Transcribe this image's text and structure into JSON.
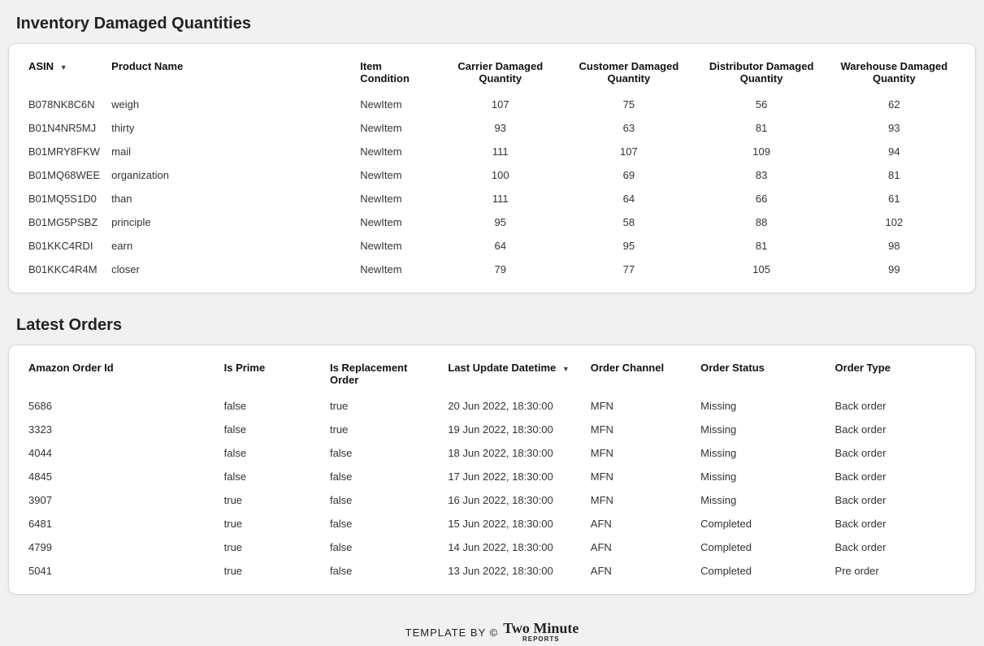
{
  "inventory": {
    "title": "Inventory Damaged Quantities",
    "headers": {
      "asin": "ASIN",
      "product_name": "Product Name",
      "item_condition": "Item Condition",
      "carrier": "Carrier Damaged Quantity",
      "customer": "Customer Damaged Quantity",
      "distributor": "Distributor Damaged Quantity",
      "warehouse": "Warehouse Damaged Quantity"
    },
    "rows": [
      {
        "asin": "B078NK8C6N",
        "product_name": "weigh",
        "item_condition": "NewItem",
        "carrier": "107",
        "customer": "75",
        "distributor": "56",
        "warehouse": "62"
      },
      {
        "asin": "B01N4NR5MJ",
        "product_name": "thirty",
        "item_condition": "NewItem",
        "carrier": "93",
        "customer": "63",
        "distributor": "81",
        "warehouse": "93"
      },
      {
        "asin": "B01MRY8FKW",
        "product_name": "mail",
        "item_condition": "NewItem",
        "carrier": "111",
        "customer": "107",
        "distributor": "109",
        "warehouse": "94"
      },
      {
        "asin": "B01MQ68WEE",
        "product_name": "organization",
        "item_condition": "NewItem",
        "carrier": "100",
        "customer": "69",
        "distributor": "83",
        "warehouse": "81"
      },
      {
        "asin": "B01MQ5S1D0",
        "product_name": "than",
        "item_condition": "NewItem",
        "carrier": "111",
        "customer": "64",
        "distributor": "66",
        "warehouse": "61"
      },
      {
        "asin": "B01MG5PSBZ",
        "product_name": "principle",
        "item_condition": "NewItem",
        "carrier": "95",
        "customer": "58",
        "distributor": "88",
        "warehouse": "102"
      },
      {
        "asin": "B01KKC4RDI",
        "product_name": "earn",
        "item_condition": "NewItem",
        "carrier": "64",
        "customer": "95",
        "distributor": "81",
        "warehouse": "98"
      },
      {
        "asin": "B01KKC4R4M",
        "product_name": "closer",
        "item_condition": "NewItem",
        "carrier": "79",
        "customer": "77",
        "distributor": "105",
        "warehouse": "99"
      }
    ]
  },
  "orders": {
    "title": "Latest Orders",
    "headers": {
      "order_id": "Amazon Order Id",
      "is_prime": "Is Prime",
      "is_replacement": "Is Replacement Order",
      "last_update": "Last Update Datetime",
      "order_channel": "Order Channel",
      "order_status": "Order Status",
      "order_type": "Order Type"
    },
    "rows": [
      {
        "order_id": "5686",
        "is_prime": "false",
        "is_replacement": "true",
        "last_update": "20 Jun 2022, 18:30:00",
        "order_channel": "MFN",
        "order_status": "Missing",
        "order_type": "Back order"
      },
      {
        "order_id": "3323",
        "is_prime": "false",
        "is_replacement": "true",
        "last_update": "19 Jun 2022, 18:30:00",
        "order_channel": "MFN",
        "order_status": "Missing",
        "order_type": "Back order"
      },
      {
        "order_id": "4044",
        "is_prime": "false",
        "is_replacement": "false",
        "last_update": "18 Jun 2022, 18:30:00",
        "order_channel": "MFN",
        "order_status": "Missing",
        "order_type": "Back order"
      },
      {
        "order_id": "4845",
        "is_prime": "false",
        "is_replacement": "false",
        "last_update": "17 Jun 2022, 18:30:00",
        "order_channel": "MFN",
        "order_status": "Missing",
        "order_type": "Back order"
      },
      {
        "order_id": "3907",
        "is_prime": "true",
        "is_replacement": "false",
        "last_update": "16 Jun 2022, 18:30:00",
        "order_channel": "MFN",
        "order_status": "Missing",
        "order_type": "Back order"
      },
      {
        "order_id": "6481",
        "is_prime": "true",
        "is_replacement": "false",
        "last_update": "15 Jun 2022, 18:30:00",
        "order_channel": "AFN",
        "order_status": "Completed",
        "order_type": "Back order"
      },
      {
        "order_id": "4799",
        "is_prime": "true",
        "is_replacement": "false",
        "last_update": "14 Jun 2022, 18:30:00",
        "order_channel": "AFN",
        "order_status": "Completed",
        "order_type": "Back order"
      },
      {
        "order_id": "5041",
        "is_prime": "true",
        "is_replacement": "false",
        "last_update": "13 Jun 2022, 18:30:00",
        "order_channel": "AFN",
        "order_status": "Completed",
        "order_type": "Pre order"
      }
    ]
  },
  "footer": {
    "text": "TEMPLATE BY ©",
    "logo_top": "Two Minute",
    "logo_bottom": "REPORTS"
  }
}
